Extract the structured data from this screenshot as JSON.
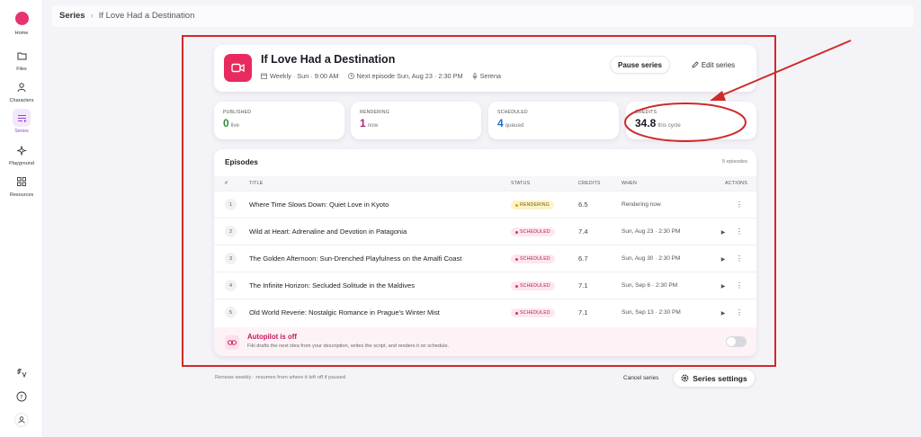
{
  "sidebar": {
    "logo_label": "Home",
    "items": [
      {
        "label": "Files",
        "icon": "folder-icon"
      },
      {
        "label": "Characters",
        "icon": "person-icon"
      },
      {
        "label": "Series",
        "icon": "list-icon"
      },
      {
        "label": "Playground",
        "icon": "sparkle-icon"
      },
      {
        "label": "Resources",
        "icon": "grid-icon"
      }
    ],
    "bottom_icons": [
      "translate-icon",
      "help-icon",
      "profile-icon"
    ]
  },
  "breadcrumb": {
    "root": "Series",
    "current": "If Love Had a Destination"
  },
  "series": {
    "title": "If Love Had a Destination",
    "schedule": "Weekly · Sun · 9:00 AM",
    "next_episode": "Next episode Sun, Aug 23 · 2:30 PM",
    "voice": "Serena",
    "pause_label": "Pause series",
    "edit_label": "Edit series",
    "accent": "#e82a5e"
  },
  "stats": {
    "published": {
      "label": "PUBLISHED",
      "value": "0",
      "sub": "live",
      "color": "#2e8b3a"
    },
    "rendering": {
      "label": "RENDERING",
      "value": "1",
      "sub": "now",
      "color": "#b0247a"
    },
    "scheduled": {
      "label": "SCHEDULED",
      "value": "4",
      "sub": "queued",
      "color": "#1f6fd1"
    },
    "credits": {
      "label": "CREDITS",
      "value": "34.8",
      "sub": "this cycle",
      "color": "#1a1a24"
    }
  },
  "episodes": {
    "title": "Episodes",
    "count": "5 episodes",
    "columns": {
      "num": "#",
      "title": "TITLE",
      "status": "STATUS",
      "credits": "CREDITS",
      "when": "WHEN",
      "actions": "ACTIONS"
    },
    "rows": [
      {
        "num": "1",
        "title": "Where Time Slows Down: Quiet Love in Kyoto",
        "status": "RENDERING",
        "credits": "6.5",
        "when": "Rendering now"
      },
      {
        "num": "2",
        "title": "Wild at Heart: Adrenaline and Devotion in Patagonia",
        "status": "SCHEDULED",
        "credits": "7.4",
        "when": "Sun, Aug 23 · 2:30 PM"
      },
      {
        "num": "3",
        "title": "The Golden Afternoon: Sun-Drenched Playfulness on the Amalfi Coast",
        "status": "SCHEDULED",
        "credits": "6.7",
        "when": "Sun, Aug 30 · 2:30 PM"
      },
      {
        "num": "4",
        "title": "The Infinite Horizon: Secluded Solitude in the Maldives",
        "status": "SCHEDULED",
        "credits": "7.1",
        "when": "Sun, Sep 6 · 2:30 PM"
      },
      {
        "num": "5",
        "title": "Old World Reverie: Nostalgic Romance in Prague's Winter Mist",
        "status": "SCHEDULED",
        "credits": "7.1",
        "when": "Sun, Sep 13 · 2:30 PM"
      }
    ]
  },
  "autopilot": {
    "title": "Autopilot is off",
    "description": "Fiki drafts the next idea from your description, writes the script, and renders it on schedule.",
    "enabled": false
  },
  "footer": {
    "note": "Renews weekly · resumes from where it left off if paused",
    "cancel_label": "Cancel series",
    "settings_label": "Series settings"
  },
  "annotation_color": "#cf2a2a"
}
